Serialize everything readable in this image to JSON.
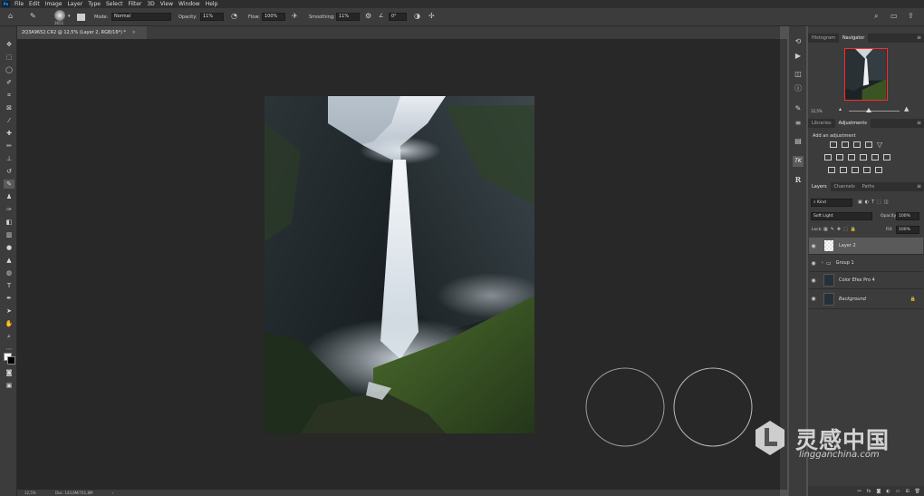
{
  "app": {
    "logo": "Ps"
  },
  "menu": [
    "File",
    "Edit",
    "Image",
    "Layer",
    "Type",
    "Select",
    "Filter",
    "3D",
    "View",
    "Window",
    "Help"
  ],
  "options": {
    "brush_size": "3651",
    "mode_label": "Mode:",
    "mode_value": "Normal",
    "opacity_label": "Opacity:",
    "opacity_value": "11%",
    "flow_label": "Flow:",
    "flow_value": "100%",
    "smoothing_label": "Smoothing:",
    "smoothing_value": "11%",
    "angle_value": "0°"
  },
  "document": {
    "tab_title": "2Q3A9652.CR2 @ 12,5% (Layer 2, RGB/16*) *",
    "close": "×"
  },
  "status": {
    "zoom": "12,5%",
    "doc": "Doc: 143,6M/741,8M"
  },
  "navigator": {
    "tabs": [
      "Histogram",
      "Navigator"
    ],
    "active_tab": 1,
    "zoom": "12,5%"
  },
  "adjustments": {
    "tabs": [
      "Libraries",
      "Adjustments"
    ],
    "active_tab": 1,
    "hint": "Add an adjustment"
  },
  "layers_panel": {
    "tabs": [
      "Layers",
      "Channels",
      "Paths"
    ],
    "active_tab": 0,
    "filter": "Kind",
    "blend_mode": "Soft Light",
    "opacity_label": "Opacity:",
    "opacity_value": "100%",
    "lock_label": "Lock:",
    "fill_label": "Fill:",
    "fill_value": "100%",
    "layers": [
      {
        "name": "Layer 2",
        "selected": true
      },
      {
        "name": "Group 1",
        "type": "group"
      },
      {
        "name": "Color Efex Pro 4"
      },
      {
        "name": "Background",
        "locked": true
      }
    ]
  },
  "footer_icons": [
    "link-icon",
    "fx-icon",
    "mask-icon",
    "adjustment-icon",
    "folder-icon",
    "new-layer-icon",
    "trash-icon"
  ],
  "watermark": {
    "main": "灵感中国",
    "sub": "lingganchina.com"
  },
  "colors": {
    "accent": "#31a8ff",
    "panel": "#3c3c3c",
    "canvas": "#282828",
    "nav_box": "#ff2a2a"
  }
}
